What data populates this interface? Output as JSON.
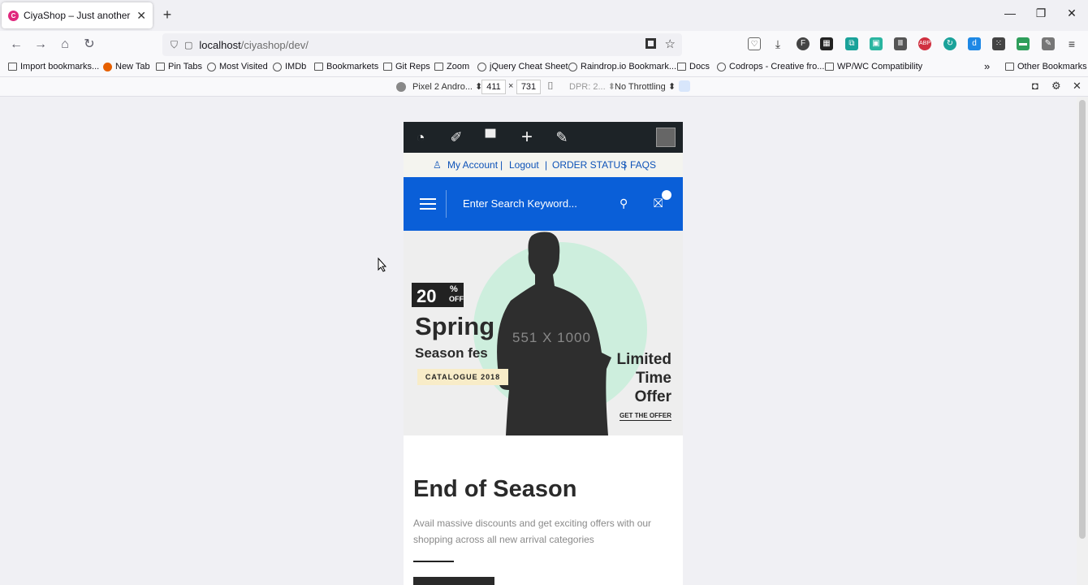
{
  "browser": {
    "tab": {
      "title": "CiyaShop – Just another WordP",
      "favicon": "ciyashop-favicon"
    },
    "new_tab_label": "+",
    "window_controls": {
      "minimize": "—",
      "restore": "❐",
      "close": "✕"
    },
    "nav": {
      "back": "←",
      "forward": "→",
      "home": "⌂",
      "reload": "↻"
    },
    "url": {
      "host": "localhost",
      "path": "/ciyashop/dev/"
    },
    "bookmarks": [
      {
        "label": "Import bookmarks...",
        "icon": "import-icon"
      },
      {
        "label": "New Tab",
        "icon": "firefox-icon"
      },
      {
        "label": "Pin Tabs",
        "icon": "folder-icon"
      },
      {
        "label": "Most Visited",
        "icon": "gear-icon"
      },
      {
        "label": "IMDb",
        "icon": "globe-icon"
      },
      {
        "label": "Bookmarkets",
        "icon": "folder-icon"
      },
      {
        "label": "Git Reps",
        "icon": "folder-icon"
      },
      {
        "label": "Zoom",
        "icon": "folder-icon"
      },
      {
        "label": "jQuery Cheat Sheet",
        "icon": "globe-icon"
      },
      {
        "label": "Raindrop.io Bookmark...",
        "icon": "globe-icon"
      },
      {
        "label": "Docs",
        "icon": "folder-icon"
      },
      {
        "label": "Codrops - Creative fro...",
        "icon": "globe-icon"
      },
      {
        "label": "WP/WC Compatibility",
        "icon": "folder-icon"
      }
    ],
    "other_bookmarks": "Other Bookmarks",
    "overflow": "»"
  },
  "rdm": {
    "device": "Pixel 2 Andro...",
    "width": "411",
    "times": "×",
    "height": "731",
    "dpr": "DPR: 2...",
    "throttling": "No Throttling"
  },
  "site": {
    "topbar": {
      "my_account": "My Account",
      "sep1": "|",
      "logout": "Logout",
      "sep2": "|",
      "order_status": "ORDER STATUS",
      "sep3": "|",
      "faqs": "FAQS"
    },
    "search_placeholder": "Enter Search Keyword...",
    "hero": {
      "badge_number": "20",
      "badge_percent": "%",
      "badge_off": "OFF",
      "title": "Spring",
      "subtitle": "Season fes",
      "tag": "CATALOGUE 2018",
      "placeholder_dims": "551 X 1000",
      "limited_line1": "Limited",
      "limited_line2": "Time",
      "limited_line3": "Offer",
      "cta": "GET THE OFFER"
    },
    "content": {
      "heading": "End of Season",
      "text": "Avail massive discounts and get exciting offers with our shopping across all new arrival categories"
    }
  },
  "colors": {
    "brand_blue": "#0a5fd8",
    "admin_bar": "#1d2327",
    "hero_circle": "#cdeedd"
  }
}
